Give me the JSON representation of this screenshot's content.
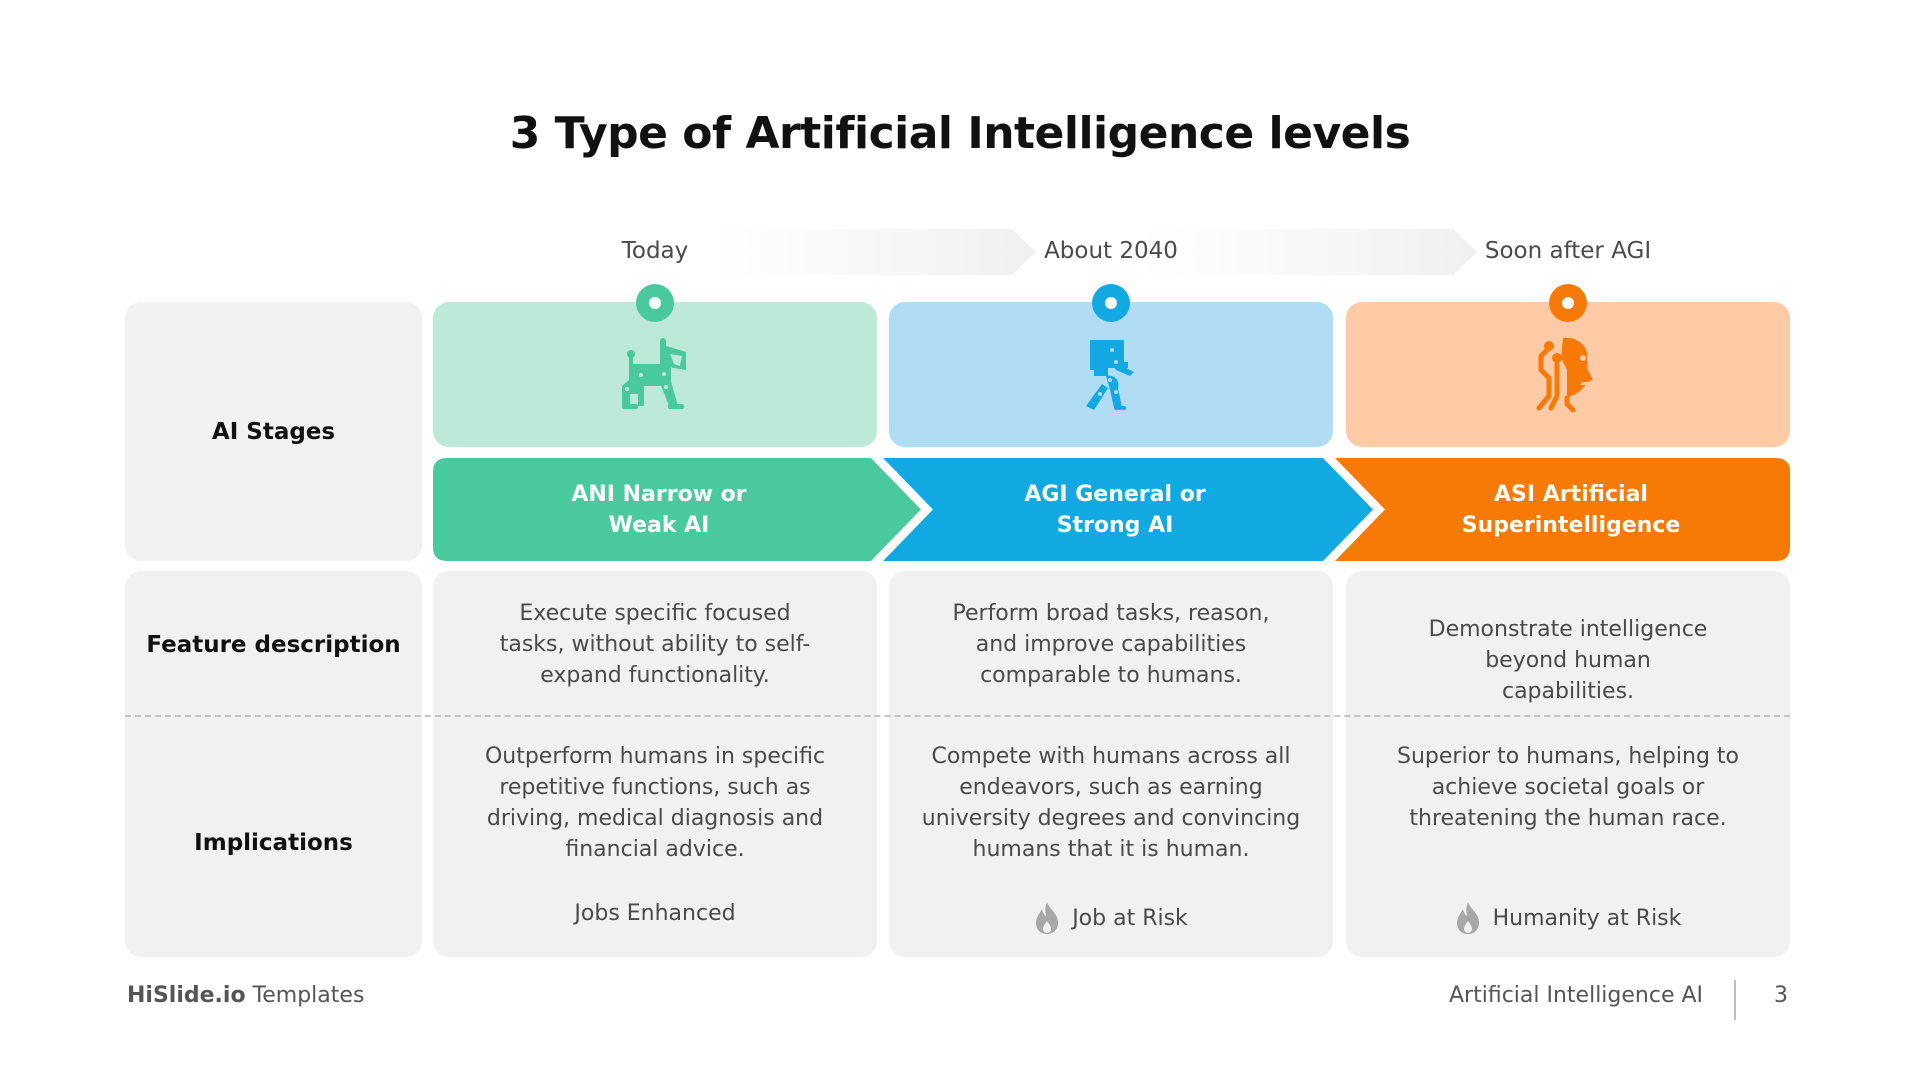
{
  "slide": {
    "title": "3 Type of Artificial Intelligence levels",
    "page_number": "3",
    "footer_brand_bold": "HiSlide.io",
    "footer_brand_rest": " Templates",
    "footer_topic": "Artificial Intelligence AI"
  },
  "timeline": [
    "Today",
    "About 2040",
    "Soon after AGI"
  ],
  "row_labels": {
    "stages": "AI Stages",
    "features": "Feature description",
    "implications": "Implications"
  },
  "stages": [
    {
      "icon": "robot-dog-icon",
      "name_line1": "ANI Narrow or",
      "name_line2": "Weak AI",
      "description": "Execute specific focused tasks, without ability to self-expand functionality.",
      "implication": "Outperform humans in specific repetitive functions, such as driving, medical diagnosis and financial advice.",
      "outcome": "Jobs Enhanced",
      "outcome_icon": null,
      "colors": {
        "main": "#4bc99e",
        "light": "#bde9d9"
      }
    },
    {
      "icon": "walking-robot-icon",
      "name_line1": "AGI General or",
      "name_line2": "Strong AI",
      "description": "Perform broad tasks, reason, and improve capabilities comparable to humans.",
      "implication": "Compete with humans across all endeavors, such as earning university degrees and convincing humans that it is human.",
      "outcome": "Job at Risk",
      "outcome_icon": "fire-icon",
      "colors": {
        "main": "#12a9e3",
        "light": "#b1ddf4"
      }
    },
    {
      "icon": "cyborg-head-icon",
      "name_line1": "ASI Artificial",
      "name_line2": "Superintelligence",
      "description": "Demonstrate intelligence beyond human capabilities.",
      "implication": "Superior to humans, helping to achieve societal goals or threatening the human race.",
      "outcome": "Humanity at Risk",
      "outcome_icon": "fire-icon",
      "colors": {
        "main": "#f77a06",
        "light": "#ffcba7"
      }
    }
  ]
}
